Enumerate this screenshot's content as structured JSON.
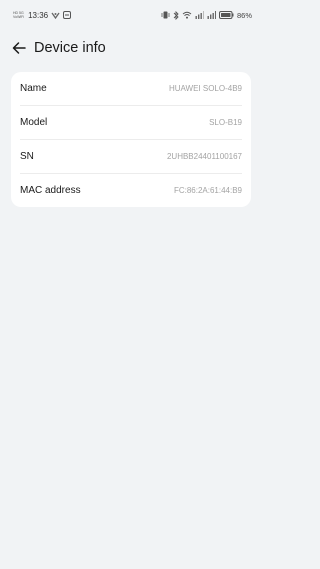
{
  "status_bar": {
    "carrier_line1": "HD 5G",
    "carrier_line2": "VoWiFi",
    "time": "13:36",
    "battery_text": "86%"
  },
  "header": {
    "title": "Device info"
  },
  "device_info": {
    "rows": [
      {
        "label": "Name",
        "value": "HUAWEI SOLO-4B9"
      },
      {
        "label": "Model",
        "value": "SLO-B19"
      },
      {
        "label": "SN",
        "value": "2UHBB24401100167"
      },
      {
        "label": "MAC address",
        "value": "FC:86:2A:61:44:B9"
      }
    ]
  },
  "icons": {
    "back": "back-arrow-icon",
    "vpn": "vpn-key-icon",
    "notification": "notification-box-icon",
    "vibrate": "vibrate-icon",
    "bluetooth": "bluetooth-icon",
    "wifi": "wifi-icon",
    "signal": "cellular-signal-icon",
    "battery": "battery-icon"
  },
  "colors": {
    "background": "#f1f3f5",
    "card": "#ffffff",
    "value_text": "#a3a3a3"
  }
}
